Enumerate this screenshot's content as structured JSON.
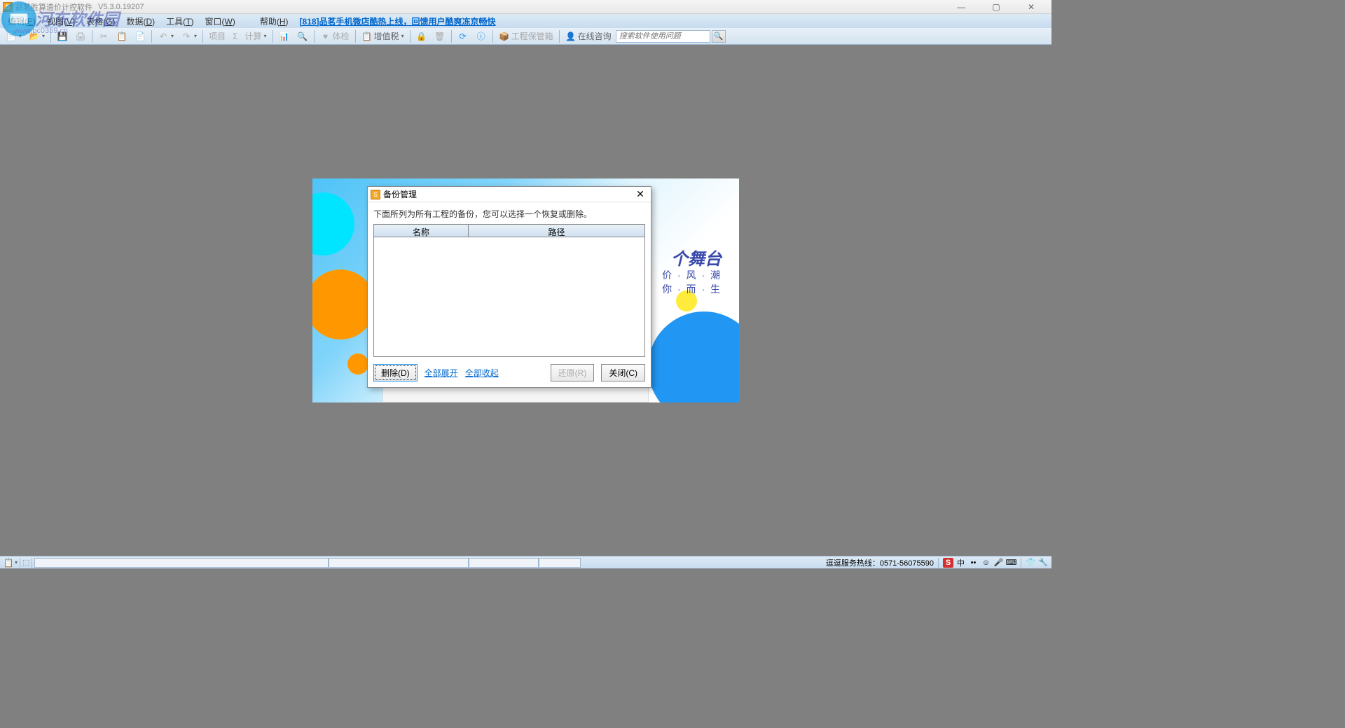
{
  "titlebar": {
    "title": "品茗胜算造价计控软件",
    "version": "V5.3.0.19207"
  },
  "watermark": {
    "text": "河东软件园",
    "url": "www.pc0359.cn"
  },
  "menu": {
    "items": [
      {
        "label": "编辑",
        "key": "E"
      },
      {
        "label": "视图",
        "key": "V"
      },
      {
        "label": "表格",
        "key": "G"
      },
      {
        "label": "数据",
        "key": "D"
      },
      {
        "label": "工具",
        "key": "T"
      },
      {
        "label": "窗口",
        "key": "W"
      },
      {
        "label": "帮助",
        "key": "H"
      }
    ],
    "promo": "[818]品茗手机微店酷热上线，回馈用户酷爽冻京畅快"
  },
  "toolbar": {
    "items": {
      "project": "项目",
      "sigma": "Σ",
      "calc": "计算",
      "check": "体检",
      "tax": "增值税",
      "project_mgmt": "工程保管箱",
      "consult": "在线咨询"
    },
    "search_placeholder": "搜索软件使用问题"
  },
  "banner": {
    "line1": "个舞台",
    "line2": "价 · 风 · 潮",
    "line3": "你 · 而 · 生"
  },
  "dialog": {
    "title": "备份管理",
    "message": "下面所列为所有工程的备份，您可以选择一个恢复或删除。",
    "columns": {
      "name": "名称",
      "path": "路径"
    },
    "buttons": {
      "delete": "删除(D)",
      "expand_all": "全部展开",
      "collapse_all": "全部收起",
      "restore": "还原(R)",
      "close": "关闭(C)"
    }
  },
  "statusbar": {
    "hotline": "逗逗服务热线：0571-56075590",
    "ime": "中"
  }
}
